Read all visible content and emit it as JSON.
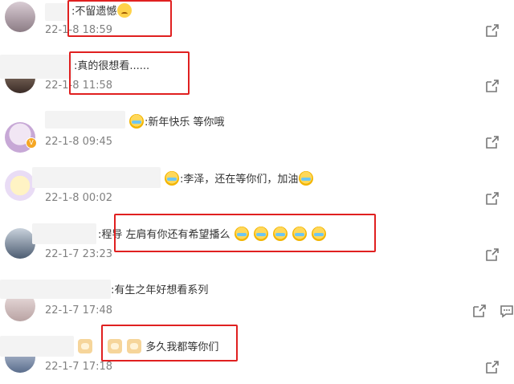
{
  "comments": [
    {
      "text": ":不留遗憾",
      "time": "22-1-8 18:59"
    },
    {
      "text": ":真的很想看......",
      "time": "22-1-8 11:58"
    },
    {
      "text": ":新年快乐 等你哦",
      "time": "22-1-8 09:45"
    },
    {
      "text": ":李泽，还在等你们，加油",
      "time": "22-1-8 00:02"
    },
    {
      "text": ":程导 左肩有你还有希望播么",
      "time": "22-1-7 23:23"
    },
    {
      "text": ":有生之年好想看系列",
      "time": "22-1-7 17:48"
    },
    {
      "text": "多久我都等你们",
      "time": "22-1-7 17:18"
    }
  ],
  "icons": {
    "share": "share-icon",
    "comment": "comment-icon"
  },
  "colors": {
    "highlight_box": "#e02020",
    "time_text": "#808080",
    "body_text": "#333333"
  }
}
